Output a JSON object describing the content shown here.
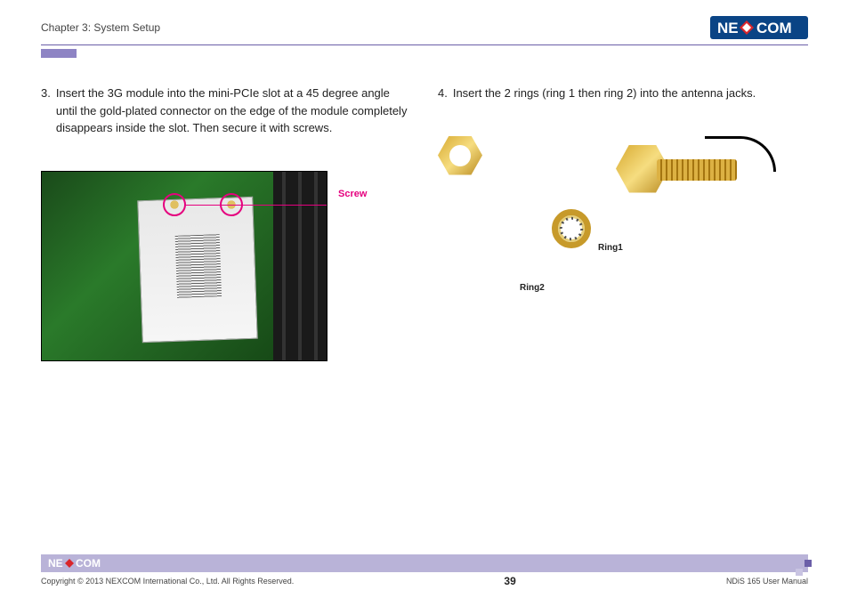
{
  "header": {
    "chapter": "Chapter 3: System Setup",
    "logo_text_left": "NE",
    "logo_text_right": "COM"
  },
  "step3": {
    "num": "3.",
    "text": "Insert the 3G module into the mini-PCIe slot at a 45 degree angle until the gold-plated connector on the edge of the module completely disappears inside the slot. Then secure it with screws.",
    "label_screw": "Screw"
  },
  "step4": {
    "num": "4.",
    "text": "Insert the 2 rings (ring 1 then ring 2) into the antenna jacks.",
    "label_ring1": "Ring1",
    "label_ring2": "Ring2"
  },
  "footer": {
    "copyright": "Copyright © 2013 NEXCOM International Co., Ltd. All Rights Reserved.",
    "page": "39",
    "manual": "NDiS 165 User Manual"
  },
  "colors": {
    "accent": "#e5007e",
    "divider": "#6b5fa8",
    "footer_bar": "#b9b3d8"
  }
}
